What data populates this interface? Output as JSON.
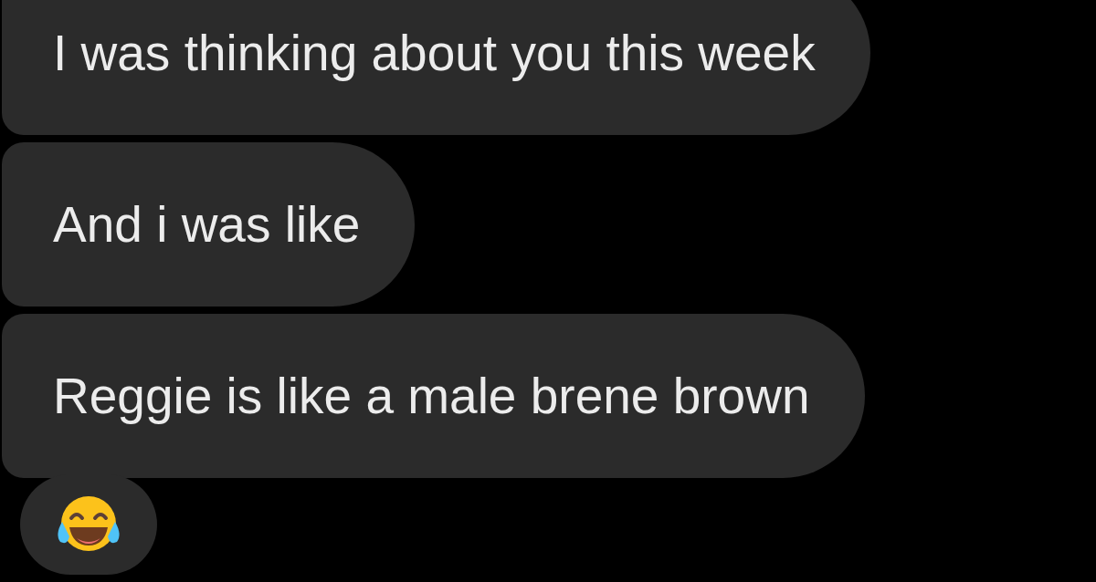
{
  "messages": [
    {
      "kind": "text",
      "text": "I was thinking about you this week"
    },
    {
      "kind": "text",
      "text": "And i was like"
    },
    {
      "kind": "text",
      "text": "Reggie is like a male brene brown"
    },
    {
      "kind": "emoji"
    }
  ]
}
